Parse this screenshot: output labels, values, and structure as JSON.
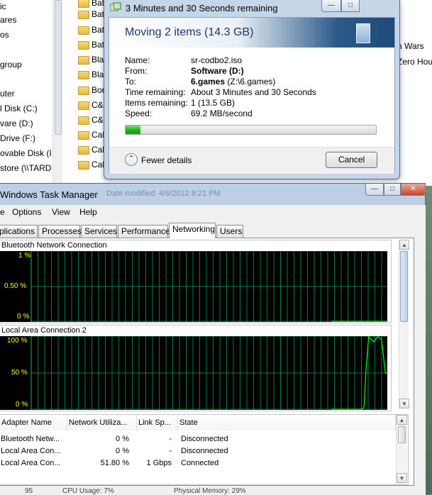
{
  "explorer": {
    "nav_items": [
      "ic",
      "ares",
      "os",
      "",
      "group",
      "",
      "uter",
      "l Disk (C:)",
      "vare (D:)",
      "Drive (F:)",
      "ovable Disk (I:",
      "store (\\\\TARD"
    ],
    "folders": [
      "Batt",
      "Batt",
      "Batt",
      "Batt",
      "Blac",
      "Blac",
      "Bor",
      "C&",
      "C&",
      "Call",
      "Call",
      "Call"
    ],
    "right_items": [
      "n Wars",
      "Zero Hou"
    ]
  },
  "copy_dialog": {
    "title": "3 Minutes and 30 Seconds remaining",
    "heading": "Moving 2 items (14.3 GB)",
    "name_label": "Name:",
    "name_value": "sr-codbo2.iso",
    "from_label": "From:",
    "from_value": "Software (D:)",
    "to_label": "To:",
    "to_value_bold": "6.games",
    "to_value_path": "(Z:\\6.games)",
    "time_label": "Time remaining:",
    "time_value": "About 3 Minutes and 30 Seconds",
    "items_label": "Items remaining:",
    "items_value": "1 (13.5 GB)",
    "speed_label": "Speed:",
    "speed_value": "69.2 MB/second",
    "progress_fraction": 0.06,
    "fewer_details_label": "Fewer details",
    "cancel_label": "Cancel"
  },
  "task_manager": {
    "title": "Windows Task Manager",
    "behind_title": "Date modified: 4/6/2012 8:21 PM",
    "menu": [
      "Options",
      "View",
      "Help"
    ],
    "menu_file_partial": "e",
    "tabs": [
      "plications",
      "Processes",
      "Services",
      "Performance",
      "Networking",
      "Users"
    ],
    "active_tab": "Networking",
    "graph1": {
      "title": "Bluetooth Network Connection",
      "ticks": [
        "1 %",
        "0.50 %",
        "0 %"
      ],
      "line_color": "#00ff00"
    },
    "graph2": {
      "title": "Local Area Connection 2",
      "ticks": [
        "100 %",
        "50 %",
        "0 %"
      ],
      "line_color": "#00ff00"
    },
    "table": {
      "headers": [
        "Adapter Name",
        "Network Utiliza...",
        "Link Sp...",
        "State"
      ],
      "rows": [
        [
          "Bluetooth Netw...",
          "0 %",
          "-",
          "Disconnected"
        ],
        [
          "Local Area Con...",
          "0 %",
          "-",
          "Disconnected"
        ],
        [
          "Local Area Con...",
          "51.80 %",
          "1 Gbps",
          "Connected"
        ]
      ]
    },
    "status_partial": [
      "95",
      "CPU Usage: 7%",
      "Physical Memory: 29%"
    ]
  },
  "colors": {
    "grid": "#008040",
    "graph_bg": "#000000",
    "tick_text": "#ffff00",
    "traffic": "#00ff00"
  }
}
